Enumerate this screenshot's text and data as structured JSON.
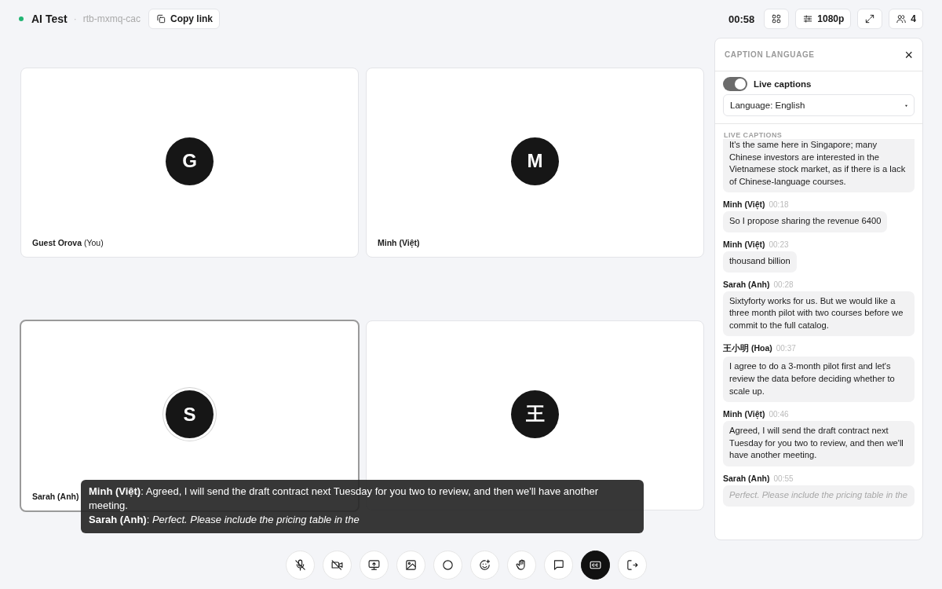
{
  "topbar": {
    "color": "#22b573",
    "title": "AI Test",
    "separator": "·",
    "room_code": "rtb-mxmq-cac",
    "copy_button": "Copy link",
    "timer": "00:58",
    "quality": "1080p",
    "participants": "4"
  },
  "tiles": [
    {
      "avatar": "G",
      "name": "**Guest Orova** (You)",
      "speaking": false
    },
    {
      "avatar": "M",
      "name": "**Minh (Việt)**",
      "speaking": false
    },
    {
      "avatar": "S",
      "name": "**Sarah (Anh)**",
      "speaking": true
    },
    {
      "avatar": "王",
      "speaking": false
    }
  ],
  "caption_overlay": {
    "lines": [
      "**Minh (Việt)**: Agreed, I will send the draft contract next Tuesday for you two to review, and then we'll have another meeting.",
      "**Sarah (Anh)**: *Perfect. Please include the pricing table in the*"
    ]
  },
  "panel": {
    "title": "CAPTION LANGUAGE",
    "close": "×",
    "live_captions": {
      "label": "Live captions",
      "on": true
    },
    "language": "Language: English",
    "section": "LIVE CAPTIONS",
    "messages": [
      {
        "text": "It's the same here in Singapore; many Chinese investors are interested in the Vietnamese stock market, as if there is a lack of Chinese-language courses.",
        "interim": false
      },
      {
        "speaker": "Minh (Việt)",
        "time": "00:18",
        "text": "So I propose sharing the revenue 6400",
        "interim": false
      },
      {
        "speaker": "Minh (Việt)",
        "time": "00:23",
        "text": "thousand billion",
        "interim": false
      },
      {
        "speaker": "Sarah (Anh)",
        "time": "00:28",
        "text": "Sixtyforty works for us. But we would like a three month pilot with two courses before we commit to the full catalog.",
        "interim": false
      },
      {
        "speaker": "王小明 (Hoa)",
        "time": "00:37",
        "text": "I agree to do a 3-month pilot first and let's review the data before deciding whether to scale up.",
        "interim": false
      },
      {
        "speaker": "Minh (Việt)",
        "time": "00:46",
        "text": "Agreed, I will send the draft contract next Tuesday for you two to review, and then we'll have another meeting.",
        "interim": false
      },
      {
        "speaker": "Sarah (Anh)",
        "time": "00:55",
        "text": "Perfect. Please include the pricing table in the",
        "interim": true
      }
    ]
  },
  "controls": [
    {
      "active": false
    },
    {
      "active": false
    },
    {
      "active": false
    },
    {
      "active": false
    },
    {
      "active": false
    },
    {
      "active": false
    },
    {
      "active": false
    },
    {
      "active": false
    },
    {
      "active": true
    },
    {
      "active": false
    }
  ]
}
